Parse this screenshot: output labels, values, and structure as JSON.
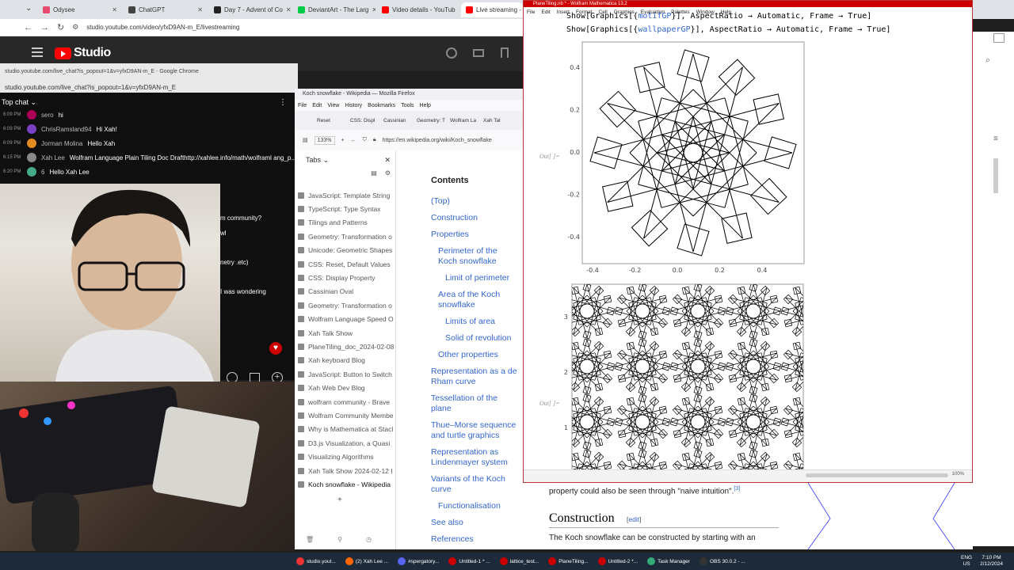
{
  "chrome": {
    "tabs": [
      {
        "label": "Odysee",
        "color": "#e64a6f"
      },
      {
        "label": "ChatGPT",
        "color": "#444"
      },
      {
        "label": "Day 7 - Advent of Co",
        "color": "#222"
      },
      {
        "label": "DeviantArt - The Larg",
        "color": "#05cc47"
      },
      {
        "label": "Video details - YouTub",
        "color": "#ff0000"
      },
      {
        "label": "Live streaming - YouTu",
        "color": "#ff0000"
      }
    ],
    "address": "studio.youtube.com/video/yfxD9AN-m_E/livestreaming"
  },
  "studio": {
    "logo": "Studio"
  },
  "chat_popout": {
    "title": "studio.youtube.com/live_chat?is_popout=1&v=yfxD9AN-m_E - Google Chrome",
    "url": "studio.youtube.com/live_chat?is_popout=1&v=yfxD9AN-m_E",
    "header": "Top chat",
    "messages": [
      {
        "time": "6:09 PM",
        "name": "sero",
        "text": "hi",
        "color": "#a05"
      },
      {
        "time": "6:09 PM",
        "name": "ChrisRamsland94",
        "text": "Hi Xah!",
        "color": "#7b3fc4"
      },
      {
        "time": "6:09 PM",
        "name": "Jorman Molina",
        "text": "Hello Xah",
        "color": "#e58a1f"
      },
      {
        "time": "6:15 PM",
        "name": "Xah Lee",
        "text": "Wolfram Language Plain Tiling Doc Drafthttp://xahlee.info/math/wolframl ang_p...",
        "color": "#888"
      },
      {
        "time": "6:20 PM",
        "name": "6",
        "text": "Hello Xah Lee",
        "color": "#4a8"
      }
    ],
    "partial_texts": [
      "m community?",
      "wl",
      "netry .etc)",
      "I was wondering"
    ]
  },
  "firefox": {
    "title": "Koch snowflake - Wikipedia — Mozilla Firefox",
    "menu": [
      "File",
      "Edit",
      "View",
      "History",
      "Bookmarks",
      "Tools",
      "Help"
    ],
    "tabs": [
      "Reset",
      "CSS: Displ",
      "Cassinian",
      "Geometry: T",
      "Wolfram La",
      "Xah Tal"
    ],
    "zoom": "133%",
    "url": "https://en.wikipedia.org/wiki/Koch_snowflake",
    "sidebar_title": "Tabs",
    "sidebar_items": [
      "JavaScript: Template String",
      "TypeScript: Type Syntax",
      "Tilings and Patterns",
      "Geometry: Transformation o",
      "Unicode: Geometric Shapes",
      "CSS: Reset, Default Values",
      "CSS: Display Property",
      "Cassinian Oval",
      "Geometry: Transformation o",
      "Wolfram Language Speed O",
      "Xah Talk Show",
      "PlaneTiling_doc_2024-02-08",
      "Xah keyboard Blog",
      "JavaScript: Button to Switch",
      "Xah Web Dev Blog",
      "wolfram community - Brave",
      "Wolfram Community Membe",
      "Why is Mathematica at Stacl",
      "D3.js Visualization, a Quasi",
      "Visualizing Algorithms",
      "Xah Talk Show 2024-02-12 I",
      "Koch snowflake - Wikipedia"
    ],
    "toc_title": "Contents",
    "toc": [
      {
        "label": "(Top)",
        "indent": 0
      },
      {
        "label": "Construction",
        "indent": 0
      },
      {
        "label": "Properties",
        "indent": 0
      },
      {
        "label": "Perimeter of the Koch snowflake",
        "indent": 1
      },
      {
        "label": "Limit of perimeter",
        "indent": 2
      },
      {
        "label": "Area of the Koch snowflake",
        "indent": 1
      },
      {
        "label": "Limits of area",
        "indent": 2
      },
      {
        "label": "Solid of revolution",
        "indent": 2
      },
      {
        "label": "Other properties",
        "indent": 1
      },
      {
        "label": "Representation as a de Rham curve",
        "indent": 0
      },
      {
        "label": "Tessellation of the plane",
        "indent": 0
      },
      {
        "label": "Thue–Morse sequence and turtle graphics",
        "indent": 0
      },
      {
        "label": "Representation as Lindenmayer system",
        "indent": 0
      },
      {
        "label": "Variants of the Koch curve",
        "indent": 0
      },
      {
        "label": "Functionalisation",
        "indent": 1
      },
      {
        "label": "See also",
        "indent": 0
      },
      {
        "label": "References",
        "indent": 0
      }
    ],
    "wiki_text": "property could also be seen through \"naive intuition\".",
    "wiki_ref": "[3]",
    "wiki_heading": "Construction",
    "wiki_edit": "edit",
    "wiki_para": "The Koch snowflake can be constructed by starting with an"
  },
  "mathematica": {
    "title": "PlaneTiling.nb * - Wolfram Mathematica 13.2",
    "menu": [
      "File",
      "Edit",
      "Insert",
      "Format",
      "Cell",
      "Graphics",
      "Evaluation",
      "Palettes",
      "Window",
      "Help"
    ],
    "code_line1_prefix": "Show[Graphics[{",
    "code_line1_var": "motifGP",
    "code_line1_suffix": "}], AspectRatio → Automatic, Frame → True]",
    "code_line2_prefix": "Show[Graphics[{",
    "code_line2_var": "wallpaperGP",
    "code_line2_suffix": "}], AspectRatio → Automatic, Frame → True]",
    "out_label": "Out[ ]=",
    "plot1_xticks": [
      "-0.4",
      "-0.2",
      "0.0",
      "0.2",
      "0.4"
    ],
    "plot1_yticks": [
      "0.4",
      "0.2",
      "0.0",
      "-0.2",
      "-0.4"
    ],
    "plot2_yticks": [
      "3",
      "2",
      "1"
    ],
    "zoom": "100%"
  },
  "taskbar": {
    "items": [
      {
        "label": "studio.yout...",
        "color": "#e33"
      },
      {
        "label": "(2) Xah Lee ...",
        "color": "#f60"
      },
      {
        "label": "#spergatory...",
        "color": "#5865f2"
      },
      {
        "label": "Untitled-1 * ...",
        "color": "#c00"
      },
      {
        "label": "lattice_test...",
        "color": "#c00"
      },
      {
        "label": "PlaneTiling...",
        "color": "#c00"
      },
      {
        "label": "Untitled-2 *...",
        "color": "#c00"
      },
      {
        "label": "Task Manager",
        "color": "#3a7"
      },
      {
        "label": "OBS 30.0.2 - ...",
        "color": "#333"
      }
    ],
    "lang": "ENG",
    "region": "US",
    "time": "7:10 PM",
    "date": "2/12/2024"
  }
}
